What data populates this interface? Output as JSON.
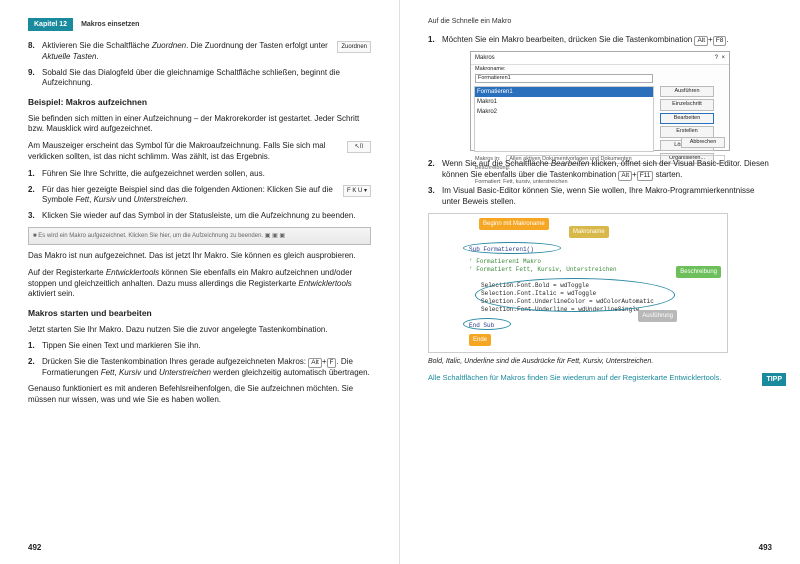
{
  "left": {
    "chapter_label": "Kapitel 12",
    "header_title": "Makros einsetzen",
    "items1": [
      {
        "n": "8.",
        "html": "Aktivieren Sie die Schaltfläche <span class='em'>Zuordnen</span>. Die Zuordnung der Tasten erfolgt unter <span class='em'>Aktuelle Tasten</span>.",
        "btn": "Zuordnen"
      },
      {
        "n": "9.",
        "html": "Sobald Sie das Dialogfeld über die gleichnamige Schaltfläche schließen, beginnt die Aufzeichnung."
      }
    ],
    "h1": "Beispiel: Makros aufzeichnen",
    "p1": "Sie befinden sich mitten in einer Aufzeichnung – der Makrorekorder ist gestartet. Jeder Schritt bzw. Mausklick wird aufgezeichnet.",
    "p2": "Am Mauszeiger erscheint das Symbol für die Makroaufzeichnung. Falls Sie sich mal verklicken sollten, ist das nicht schlimm. Was zählt, ist das Ergebnis.",
    "cursor_icon": "↖⌷",
    "items2": [
      {
        "n": "1.",
        "html": "Führen Sie Ihre Schritte, die aufgezeichnet werden sollen, aus."
      },
      {
        "n": "2.",
        "html": "Für das hier gezeigte Beispiel sind das die folgenden Aktionen: Klicken Sie auf die Symbole <span class='em'>Fett</span>, <span class='em'>Kursiv</span> und <span class='em'>Unterstreichen</span>.",
        "btn": "F K U ▾"
      },
      {
        "n": "3.",
        "html": "Klicken Sie wieder auf das Symbol in der Statusleiste, um die Aufzeichnung zu beenden."
      }
    ],
    "strip": "■ Es wird ein Makro aufgezeichnet. Klicken Sie hier, um die Aufzeichnung zu beenden. ▣ ▣ ▣",
    "p3": "Das Makro ist nun aufgezeichnet. Das ist jetzt Ihr Makro. Sie können es gleich ausprobieren.",
    "p4": "Auf der Registerkarte <span class='em'>Entwicklertools</span> können Sie ebenfalls ein Makro aufzeichnen und/oder stoppen und gleichzeitlich anhalten. Dazu muss allerdings die Registerkarte <span class='em'>Entwicklertools</span> aktiviert sein.",
    "h2": "Makros starten und bearbeiten",
    "p5": "Jetzt starten Sie Ihr Makro. Dazu nutzen Sie die zuvor angelegte Tastenkombination.",
    "items3": [
      {
        "n": "1.",
        "html": "Tippen Sie einen Text und markieren Sie ihn."
      },
      {
        "n": "2.",
        "html": "Drücken Sie die Tastenkombination Ihres gerade aufgezeichneten Makros: <span class='kbd'>Alt</span>+<span class='kbd'>F</span>. Die Formatierungen <span class='em'>Fett</span>, <span class='em'>Kursiv</span> und <span class='em'>Unterstreichen</span> werden gleichzeitig automatisch übertragen."
      }
    ],
    "p6": "Genauso funktioniert es mit anderen Befehlsreihenfolgen, die Sie aufzeichnen möchten. Sie müssen nur wissen, was und wie Sie es haben wollen.",
    "page_num": "492"
  },
  "right": {
    "header_title": "Auf die Schnelle ein Makro",
    "items1": [
      {
        "n": "1.",
        "html": "Möchten Sie ein Makro bearbeiten, drücken Sie die Tastenkombination <span class='kbd'>Alt</span>+<span class='kbd'>F8</span>."
      }
    ],
    "dialog": {
      "title": "Makros",
      "q": "?",
      "x": "×",
      "name_label": "Makroname:",
      "input": "Formatieren1",
      "list_sel": "Formatieren1",
      "list1": "Makro1",
      "list2": "Makro2",
      "btns": [
        "Ausführen",
        "Einzelschritt",
        "Bearbeiten",
        "Erstellen",
        "Löschen...",
        "Organisieren..."
      ],
      "in_label": "Makros in:",
      "in_val": "Allen aktiven Dokumentvorlagen und Dokumenten",
      "desc_label": "Beschreibung:",
      "desc_val": "Formatiert: Fett, kursiv, unterstreichen",
      "close": "Abbrechen"
    },
    "items2": [
      {
        "n": "2.",
        "html": "Wenn Sie auf die Schaltfläche <span class='em'>Bearbeiten</span> klicken, öffnet sich der Visual Basic-Editor. Diesen können Sie ebenfalls über die Tastenkombination <span class='kbd'>Alt</span>+<span class='kbd'>F11</span> starten."
      },
      {
        "n": "3.",
        "html": "Im Visual Basic-Editor können Sie, wenn Sie wollen, Ihre Makro-Programmierkenntnisse unter Beweis stellen."
      }
    ],
    "vb": {
      "tag_begin": "Beginn mit Makroname",
      "tag_name": "Makroname",
      "tag_desc": "Beschreibung",
      "tag_exec": "Ausführung",
      "tag_end": "Ende",
      "code_sub": "Sub Formatieren1()",
      "code_c1": "' Formatieren1 Makro",
      "code_c2": "' Formatiert Fett, Kursiv, Unterstreichen",
      "code_l1": "Selection.Font.Bold = wdToggle",
      "code_l2": "Selection.Font.Italic = wdToggle",
      "code_l3": "Selection.Font.UnderlineColor = wdColorAutomatic",
      "code_l4": "Selection.Font.Underline = wdUnderlineSingle",
      "code_end": "End Sub"
    },
    "caption": "Bold, Italic, Underline sind die Ausdrücke für Fett, Kursiv, Unterstreichen.",
    "tip_text": "Alle Schaltflächen für Makros finden Sie wiederum auf der Registerkarte Entwicklertools.",
    "tip_badge": "TIPP",
    "page_num": "493"
  }
}
